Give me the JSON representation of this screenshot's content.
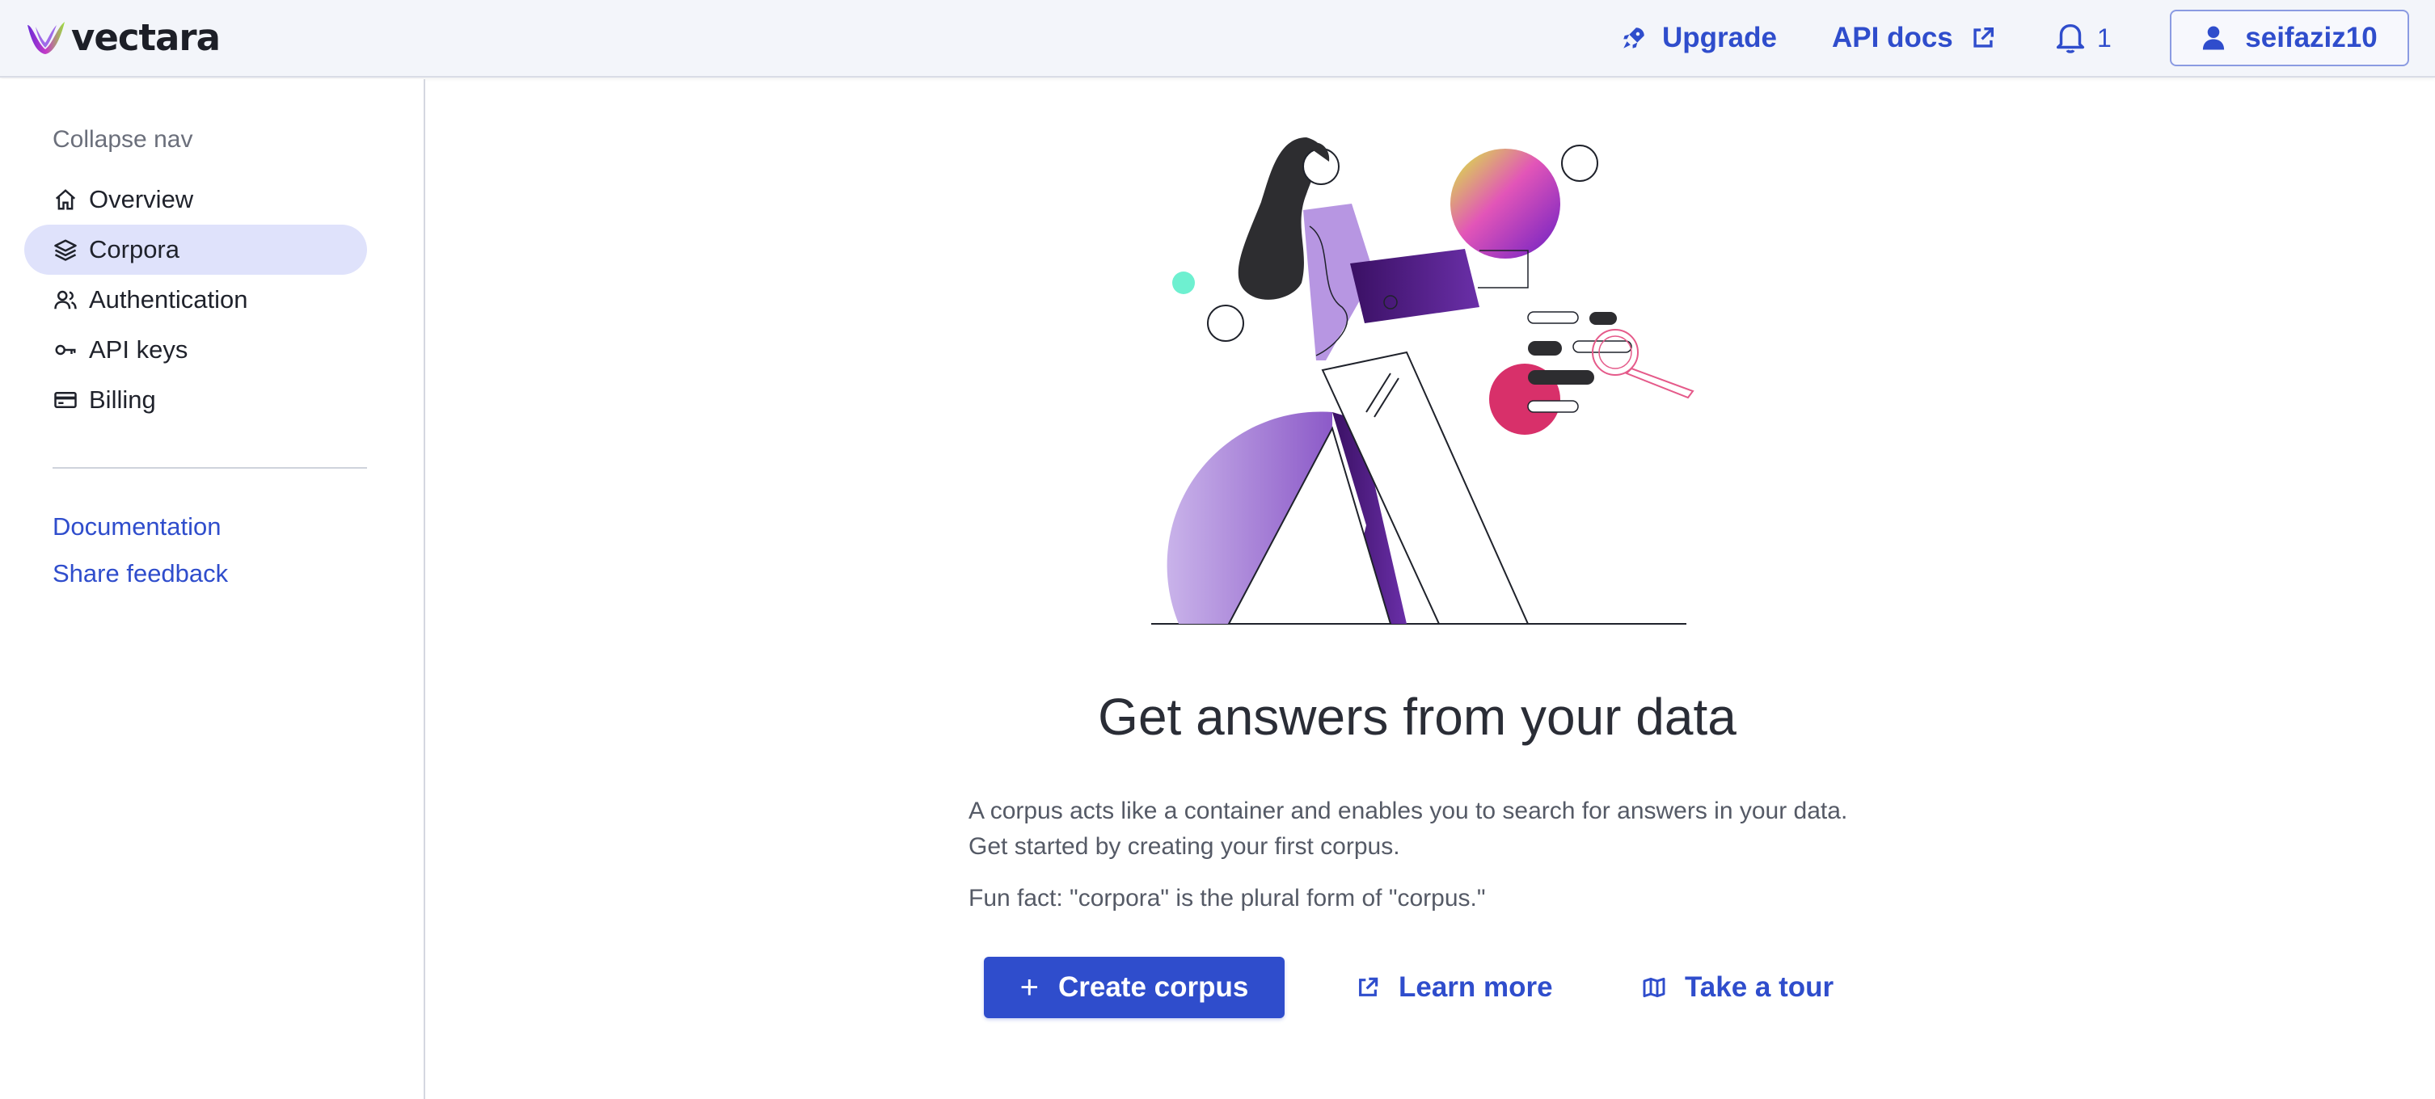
{
  "brand": {
    "name": "vectara"
  },
  "header": {
    "upgrade_label": "Upgrade",
    "api_docs_label": "API docs",
    "notification_count": "1",
    "username": "seifaziz10"
  },
  "sidebar": {
    "collapse_label": "Collapse nav",
    "items": [
      {
        "label": "Overview",
        "icon": "home-icon"
      },
      {
        "label": "Corpora",
        "icon": "layers-icon",
        "active": true
      },
      {
        "label": "Authentication",
        "icon": "users-icon"
      },
      {
        "label": "API keys",
        "icon": "key-icon"
      },
      {
        "label": "Billing",
        "icon": "credit-card-icon"
      }
    ],
    "links": [
      {
        "label": "Documentation"
      },
      {
        "label": "Share feedback"
      }
    ]
  },
  "main": {
    "title": "Get answers from your data",
    "description": "A corpus acts like a container and enables you to search for answers in your data. Get started by creating your first corpus.",
    "fun_fact": "Fun fact: \"corpora\" is the plural form of \"corpus.\"",
    "create_button": "Create corpus",
    "learn_more": "Learn more",
    "take_tour": "Take a tour"
  },
  "colors": {
    "accent": "#2f4dcc",
    "active_nav_bg": "#dfe2fb",
    "header_bg": "#f3f5fa"
  }
}
